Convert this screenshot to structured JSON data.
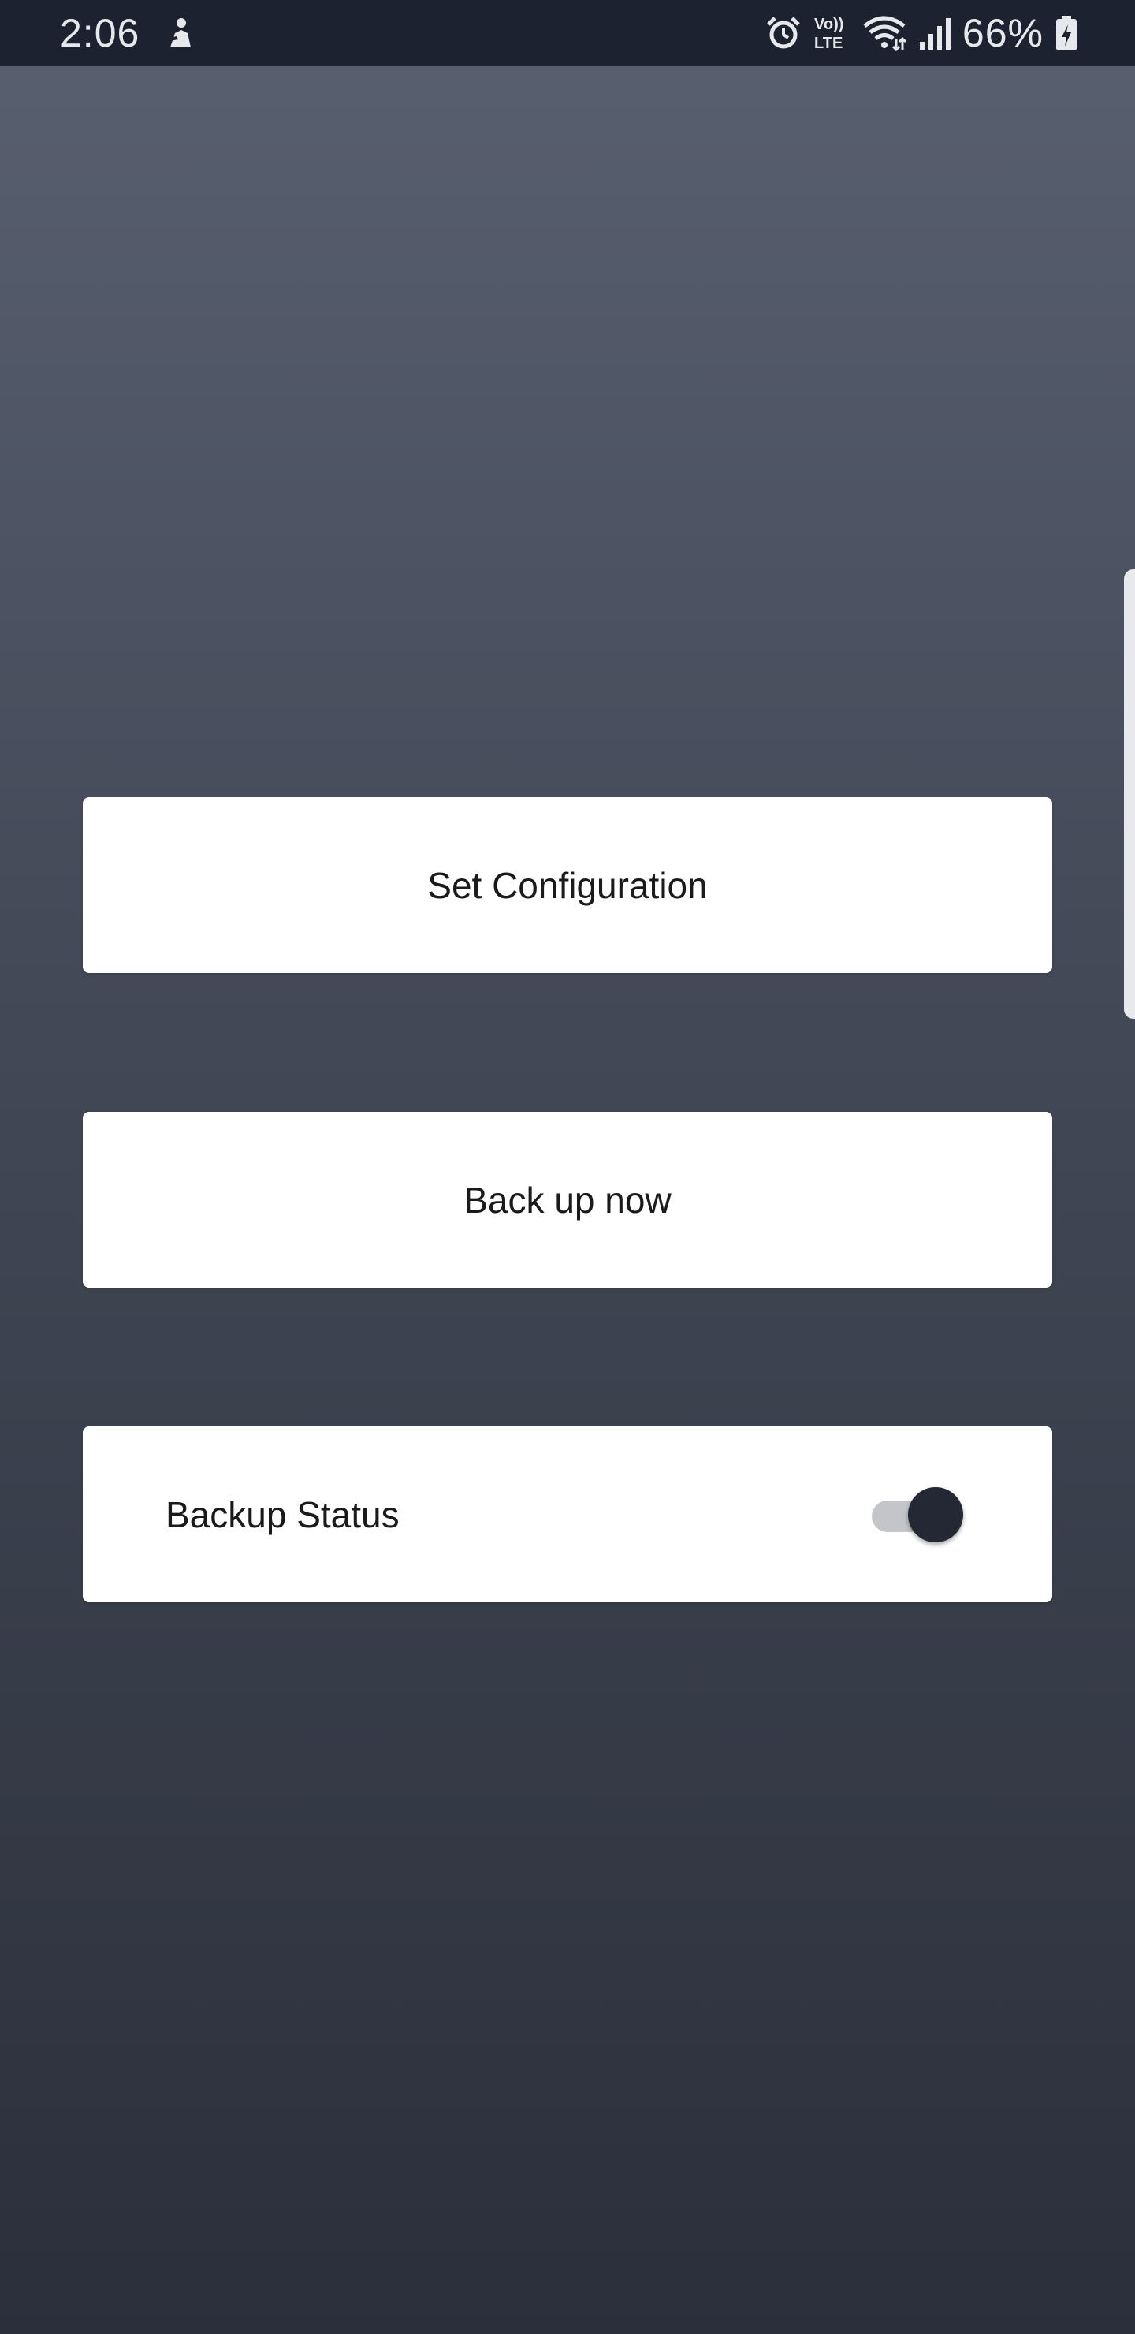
{
  "status_bar": {
    "time": "2:06",
    "battery_percent": "66%",
    "left_icon": "notification-icon",
    "right_icons": [
      "alarm-icon",
      "volte-icon",
      "wifi-icon",
      "signal-icon",
      "battery-icon"
    ],
    "volte_top": "Vo))",
    "volte_bottom": "LTE"
  },
  "actions": {
    "set_configuration": "Set Configuration",
    "back_up_now": "Back up now"
  },
  "backup_status": {
    "label": "Backup Status",
    "toggle_on": true
  },
  "colors": {
    "status_bar_bg": "#1d2230",
    "background_top": "#596070",
    "background_bottom": "#2b2f3b",
    "card_bg": "#ffffff",
    "toggle_thumb": "#232834",
    "toggle_track": "#c4c5c9"
  }
}
